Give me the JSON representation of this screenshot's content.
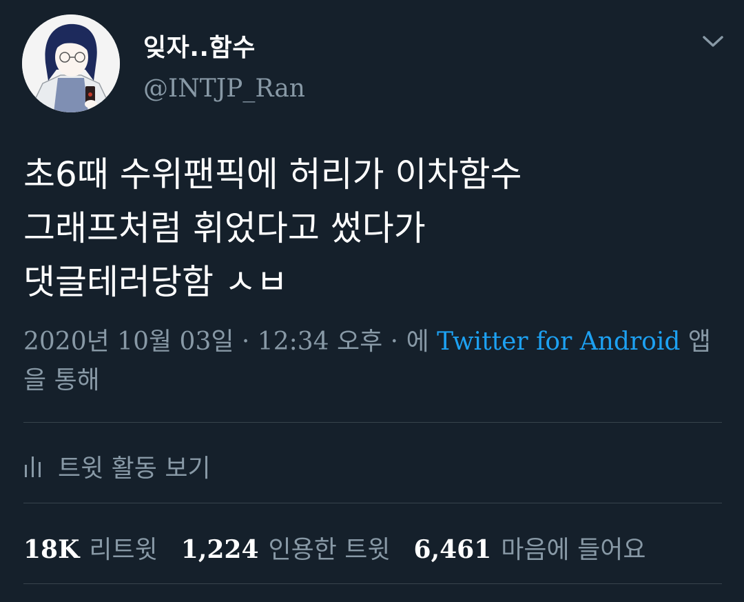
{
  "author": {
    "display_name": "잊자..함수",
    "handle": "@INTJP_Ran",
    "avatar_icon": "profile-avatar"
  },
  "tweet": {
    "text": "초6때 수위팬픽에 허리가 이차함수\n그래프처럼 휘었다고 썼다가\n댓글테러당함 ㅅㅂ"
  },
  "meta": {
    "timestamp": "2020년 10월 03일 · 12:34 오후 · 에 ",
    "source": "Twitter for Android",
    "via_suffix": " 앱을 통해"
  },
  "activity": {
    "label": "트윗 활동 보기",
    "icon": "analytics-icon"
  },
  "stats": {
    "retweets_count": "18K",
    "retweets_label": "리트윗",
    "quotes_count": "1,224",
    "quotes_label": "인용한 트윗",
    "likes_count": "6,461",
    "likes_label": "마음에 들어요"
  },
  "colors": {
    "background": "#15202b",
    "text": "#ffffff",
    "secondary_text": "#8899a6",
    "link": "#1da1f2",
    "divider": "#38444d"
  }
}
